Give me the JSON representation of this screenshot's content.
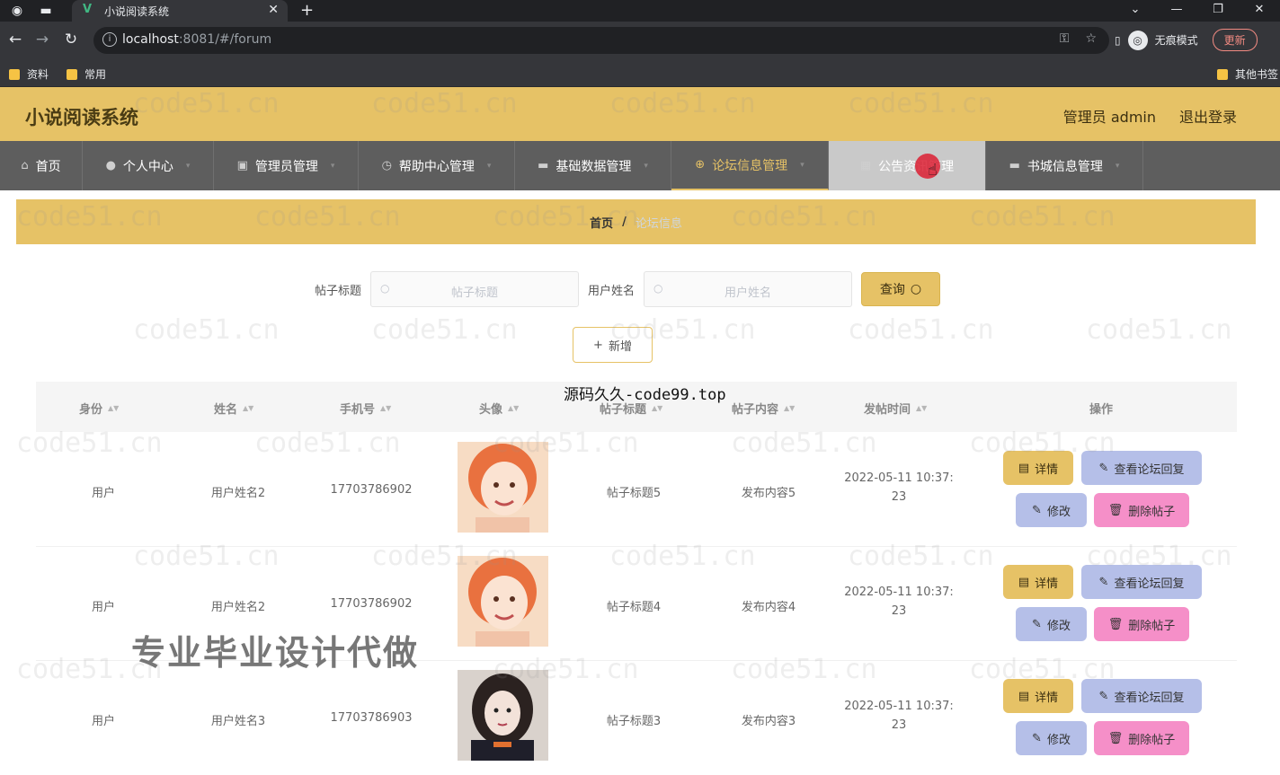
{
  "browser": {
    "tab_title": "小说阅读系统",
    "url_host": "localhost",
    "url_rest": ":8081/#/forum",
    "incognito_label": "无痕模式",
    "update_label": "更新",
    "bookmarks": [
      "资料",
      "常用"
    ],
    "other_bookmarks": "其他书签"
  },
  "header": {
    "title": "小说阅读系统",
    "user": "管理员 admin",
    "logout": "退出登录"
  },
  "nav": [
    {
      "label": "首页",
      "icon": "home-icon"
    },
    {
      "label": "个人中心",
      "icon": "user-icon"
    },
    {
      "label": "管理员管理",
      "icon": "camera-icon"
    },
    {
      "label": "帮助中心管理",
      "icon": "clock-icon"
    },
    {
      "label": "基础数据管理",
      "icon": "monitor-icon"
    },
    {
      "label": "论坛信息管理",
      "icon": "target-icon"
    },
    {
      "label": "公告资讯管理",
      "icon": "image-icon"
    },
    {
      "label": "书城信息管理",
      "icon": "monitor-icon"
    }
  ],
  "breadcrumb": {
    "home": "首页",
    "separator": "/",
    "current": "论坛信息"
  },
  "search": {
    "label1": "帖子标题",
    "placeholder1": "帖子标题",
    "label2": "用户姓名",
    "placeholder2": "用户姓名",
    "query_label": "查询"
  },
  "add_label": "新增",
  "table": {
    "headers": [
      "身份",
      "姓名",
      "手机号",
      "头像",
      "帖子标题",
      "帖子内容",
      "发帖时间",
      "操作"
    ],
    "rows": [
      {
        "role": "用户",
        "name": "用户姓名2",
        "phone": "17703786902",
        "title": "帖子标题5",
        "content": "发布内容5",
        "time1": "2022-05-11 10:37:",
        "time2": "23",
        "avatar": "avatar-girl-red"
      },
      {
        "role": "用户",
        "name": "用户姓名2",
        "phone": "17703786902",
        "title": "帖子标题4",
        "content": "发布内容4",
        "time1": "2022-05-11 10:37:",
        "time2": "23",
        "avatar": "avatar-girl-red"
      },
      {
        "role": "用户",
        "name": "用户姓名3",
        "phone": "17703786903",
        "title": "帖子标题3",
        "content": "发布内容3",
        "time1": "2022-05-11 10:37:",
        "time2": "23",
        "avatar": "avatar-girl-dark"
      }
    ],
    "actions": {
      "detail": "详情",
      "reply": "查看论坛回复",
      "edit": "修改",
      "delete": "删除帖子"
    }
  },
  "overlays": {
    "watermark": "code51.cn",
    "promo_top": "源码久久-code99.top",
    "promo_big": "专业毕业设计代做"
  },
  "colors": {
    "accent": "#e6c266",
    "nav_bg": "#5e5e5e",
    "reply_btn": "#b5bfe8",
    "delete_btn": "#f58fc8"
  }
}
